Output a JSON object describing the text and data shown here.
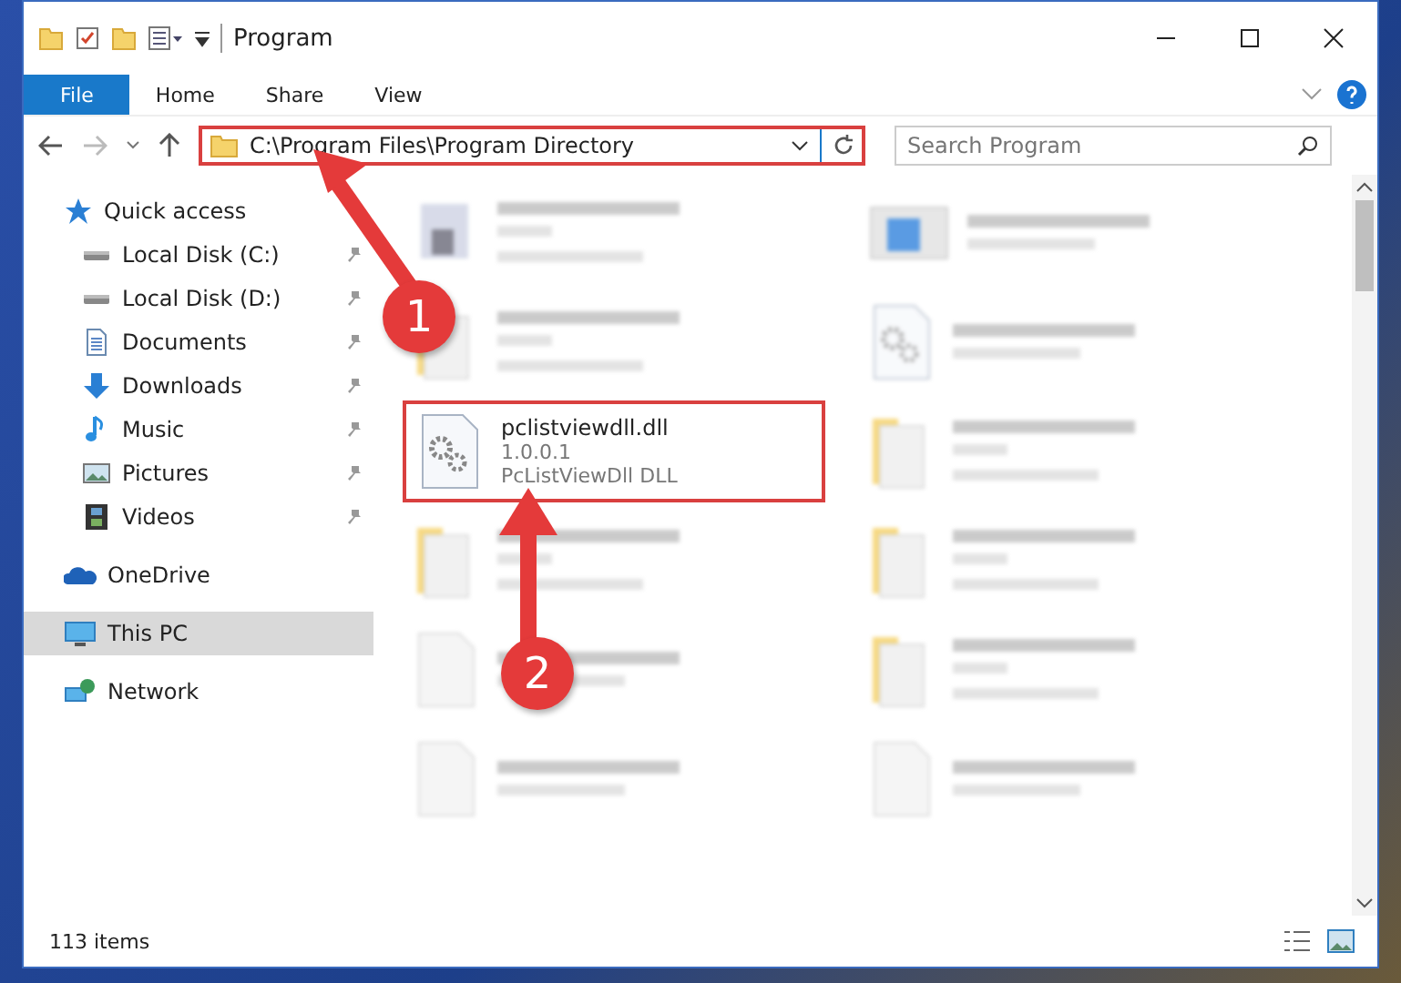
{
  "window": {
    "title": "Program"
  },
  "ribbon_tabs": [
    {
      "label": "File",
      "selected": true
    },
    {
      "label": "Home",
      "selected": false
    },
    {
      "label": "Share",
      "selected": false
    },
    {
      "label": "View",
      "selected": false
    }
  ],
  "address_bar": {
    "path": "C:\\Program Files\\Program Directory",
    "highlighted": true
  },
  "search": {
    "placeholder": "Search Program"
  },
  "sidebar": {
    "items": [
      {
        "label": "Quick access",
        "kind": "star",
        "selected": false,
        "children": [
          {
            "label": "Local Disk (C:)",
            "kind": "disk",
            "pinned": true,
            "selected": false
          },
          {
            "label": "Local Disk (D:)",
            "kind": "disk",
            "pinned": true,
            "selected": false
          },
          {
            "label": "Documents",
            "kind": "document",
            "pinned": true,
            "selected": false
          },
          {
            "label": "Downloads",
            "kind": "download",
            "pinned": true,
            "selected": false
          },
          {
            "label": "Music",
            "kind": "music",
            "pinned": true,
            "selected": false
          },
          {
            "label": "Pictures",
            "kind": "picture",
            "pinned": true,
            "selected": false
          },
          {
            "label": "Videos",
            "kind": "video",
            "pinned": true,
            "selected": false
          }
        ]
      },
      {
        "label": "OneDrive",
        "kind": "cloud",
        "selected": false
      },
      {
        "label": "This PC",
        "kind": "pc",
        "selected": true
      },
      {
        "label": "Network",
        "kind": "network",
        "selected": false
      }
    ]
  },
  "files": [
    {
      "kind": "app",
      "blurred": true,
      "highlighted": false
    },
    {
      "kind": "window",
      "blurred": true,
      "highlighted": false
    },
    {
      "kind": "folder",
      "blurred": true,
      "highlighted": false
    },
    {
      "kind": "dll",
      "blurred": true,
      "highlighted": false
    },
    {
      "kind": "dll",
      "blurred": false,
      "highlighted": true,
      "lines": [
        "pclistviewdll.dll",
        "1.0.0.1",
        "PcListViewDll DLL"
      ]
    },
    {
      "kind": "folder",
      "blurred": true,
      "highlighted": false
    },
    {
      "kind": "folder",
      "blurred": true,
      "highlighted": false
    },
    {
      "kind": "folder",
      "blurred": true,
      "highlighted": false
    },
    {
      "kind": "blank",
      "blurred": true,
      "highlighted": false
    },
    {
      "kind": "folder",
      "blurred": true,
      "highlighted": false
    },
    {
      "kind": "blank",
      "blurred": true,
      "highlighted": false
    },
    {
      "kind": "blank",
      "blurred": true,
      "highlighted": false
    }
  ],
  "status_bar": {
    "count": "113 items"
  },
  "annotations": [
    {
      "label": "1"
    },
    {
      "label": "2"
    }
  ]
}
